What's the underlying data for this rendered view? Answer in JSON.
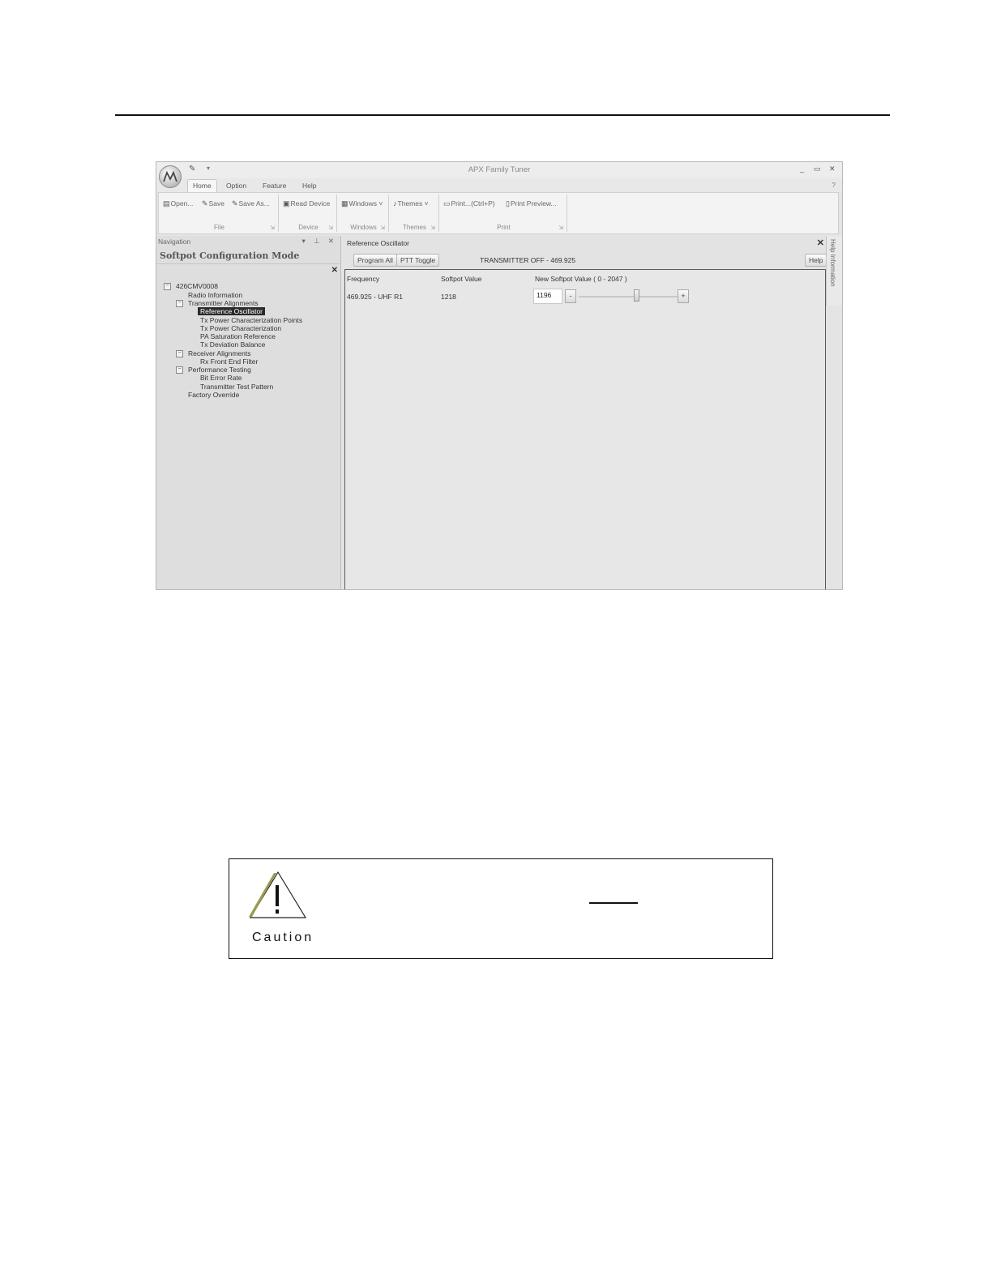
{
  "window": {
    "app_title": "APX Family Tuner",
    "controls": [
      "_",
      "▭",
      "✕"
    ],
    "menu_tabs": [
      "Home",
      "Option",
      "Feature",
      "Help"
    ],
    "help_glyph": "?"
  },
  "ribbon": {
    "file": {
      "open": "Open...",
      "save": "Save",
      "save_as": "Save As...",
      "label": "File"
    },
    "device": {
      "read_device": "Read Device",
      "label": "Device"
    },
    "windows": {
      "windows": "Windows ˅",
      "label": "Windows"
    },
    "themes": {
      "themes": "Themes ˅",
      "label": "Themes"
    },
    "print": {
      "print": "Print...(Ctrl+P)",
      "preview": "Print Preview...",
      "label": "Print"
    }
  },
  "navigation": {
    "header": "Navigation",
    "pins": "▾ ⊥ ✕",
    "mode_title": "Softpot Configuration Mode",
    "close": "✕",
    "tree": {
      "root": "426CMV0008",
      "radio_info": "Radio Information",
      "tx_align": "Transmitter Alignments",
      "ref_osc": "Reference Oscillator",
      "tx_pcp": "Tx Power Characterization Points",
      "tx_pc": "Tx Power Characterization",
      "pa_sat": "PA Saturation Reference",
      "tx_dev": "Tx Deviation Balance",
      "rx_align": "Receiver Alignments",
      "rx_fef": "Rx Front End Filter",
      "perf": "Performance Testing",
      "ber": "Bit Error Rate",
      "ttp": "Transmitter Test Pattern",
      "factory": "Factory Override"
    }
  },
  "content": {
    "title": "Reference Oscillator",
    "close": "✕",
    "program_all": "Program All",
    "ptt_toggle": "PTT Toggle",
    "tx_status": "TRANSMITTER OFF - 469.925",
    "help": "Help",
    "columns": [
      "Frequency",
      "Softpot Value",
      "New Softpot Value ( 0 - 2047 )"
    ],
    "row": {
      "frequency": "469.925 - UHF R1",
      "softpot": "1218",
      "new_value": "1196",
      "minus": "-",
      "plus": "+"
    },
    "slider_fraction": 0.584
  },
  "help_panel": {
    "label": "Help Information"
  },
  "caution": {
    "label": "Caution"
  }
}
